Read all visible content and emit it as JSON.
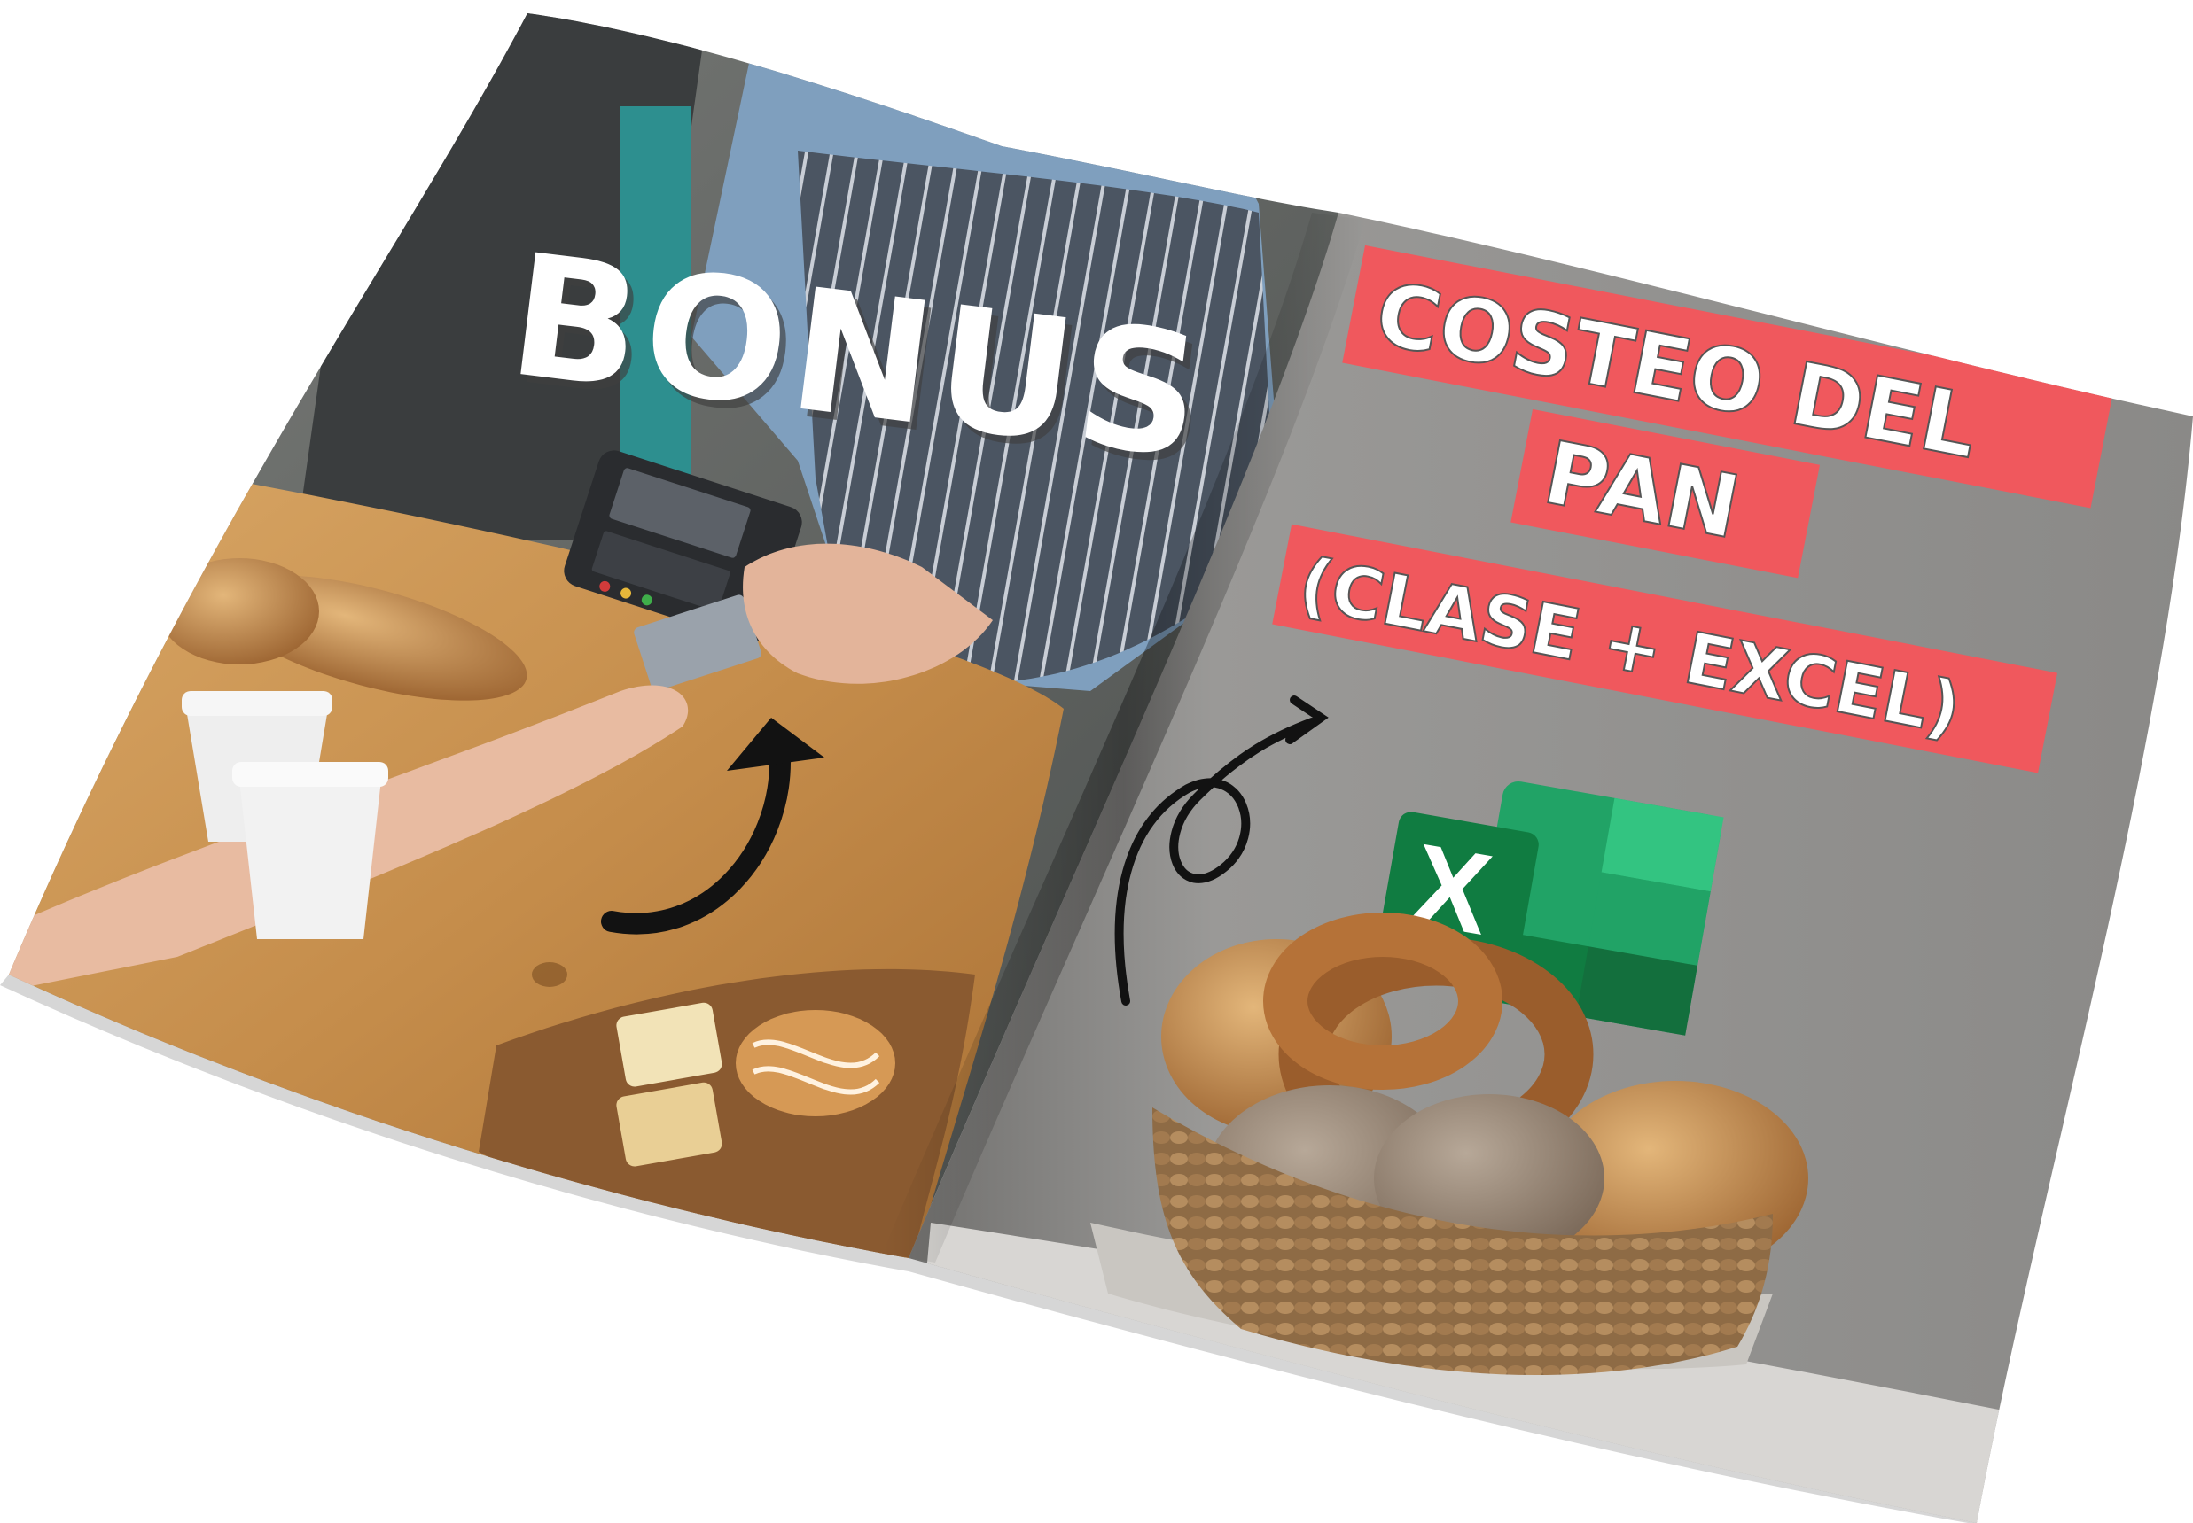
{
  "left_page": {
    "headline": "BONUS"
  },
  "right_page": {
    "title_lines": [
      "COSTEO DEL",
      "PAN",
      "(CLASE + EXCEL)"
    ],
    "excel_letter": "X"
  },
  "colors": {
    "title_band": "#f0585d",
    "right_page_bg": "#8f8e8c",
    "excel_dark": "#107c41",
    "excel_light": "#33c481",
    "wood": "#c8924f",
    "apron": "#4d5866",
    "shirt": "#7f9fbe"
  },
  "icons": {
    "left_arrow": "curved-arrow-icon",
    "right_arrow": "looped-arrow-icon",
    "excel": "excel-logo-icon"
  }
}
